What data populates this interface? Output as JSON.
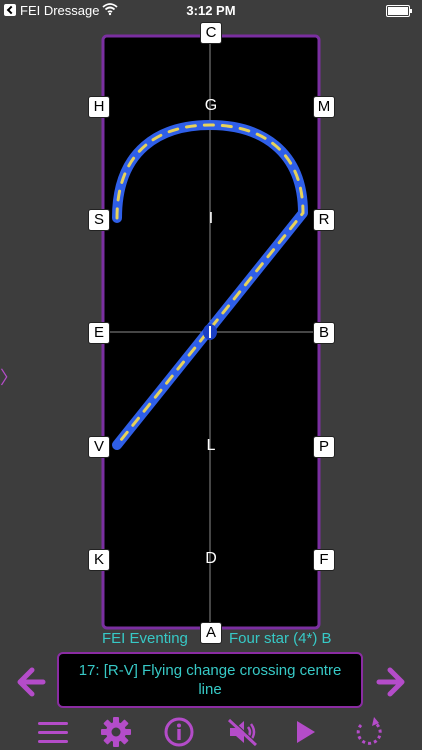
{
  "status_bar": {
    "app_name": "FEI Dressage",
    "time": "3:12 PM"
  },
  "arena": {
    "markers": {
      "top": "C",
      "bottom": "A",
      "left": [
        "H",
        "S",
        "E",
        "V",
        "K"
      ],
      "right": [
        "M",
        "R",
        "B",
        "P",
        "F"
      ]
    },
    "centre_line_letters": [
      "G",
      "I",
      "X",
      "L",
      "D"
    ],
    "colors": {
      "border": "#7a2fa0",
      "ground": "#000000",
      "track": "#2f5fe8",
      "track_dash": "#e7d25a"
    }
  },
  "test": {
    "name": "FEI Eventing",
    "level": "Four star (4*) B"
  },
  "movement": {
    "text": "17: [R-V] Flying change crossing centre line"
  },
  "toolbar": {
    "icons": [
      "menu-icon",
      "gear-icon",
      "info-icon",
      "mute-icon",
      "play-icon",
      "replay-icon"
    ],
    "accent": "#b44cc9"
  }
}
